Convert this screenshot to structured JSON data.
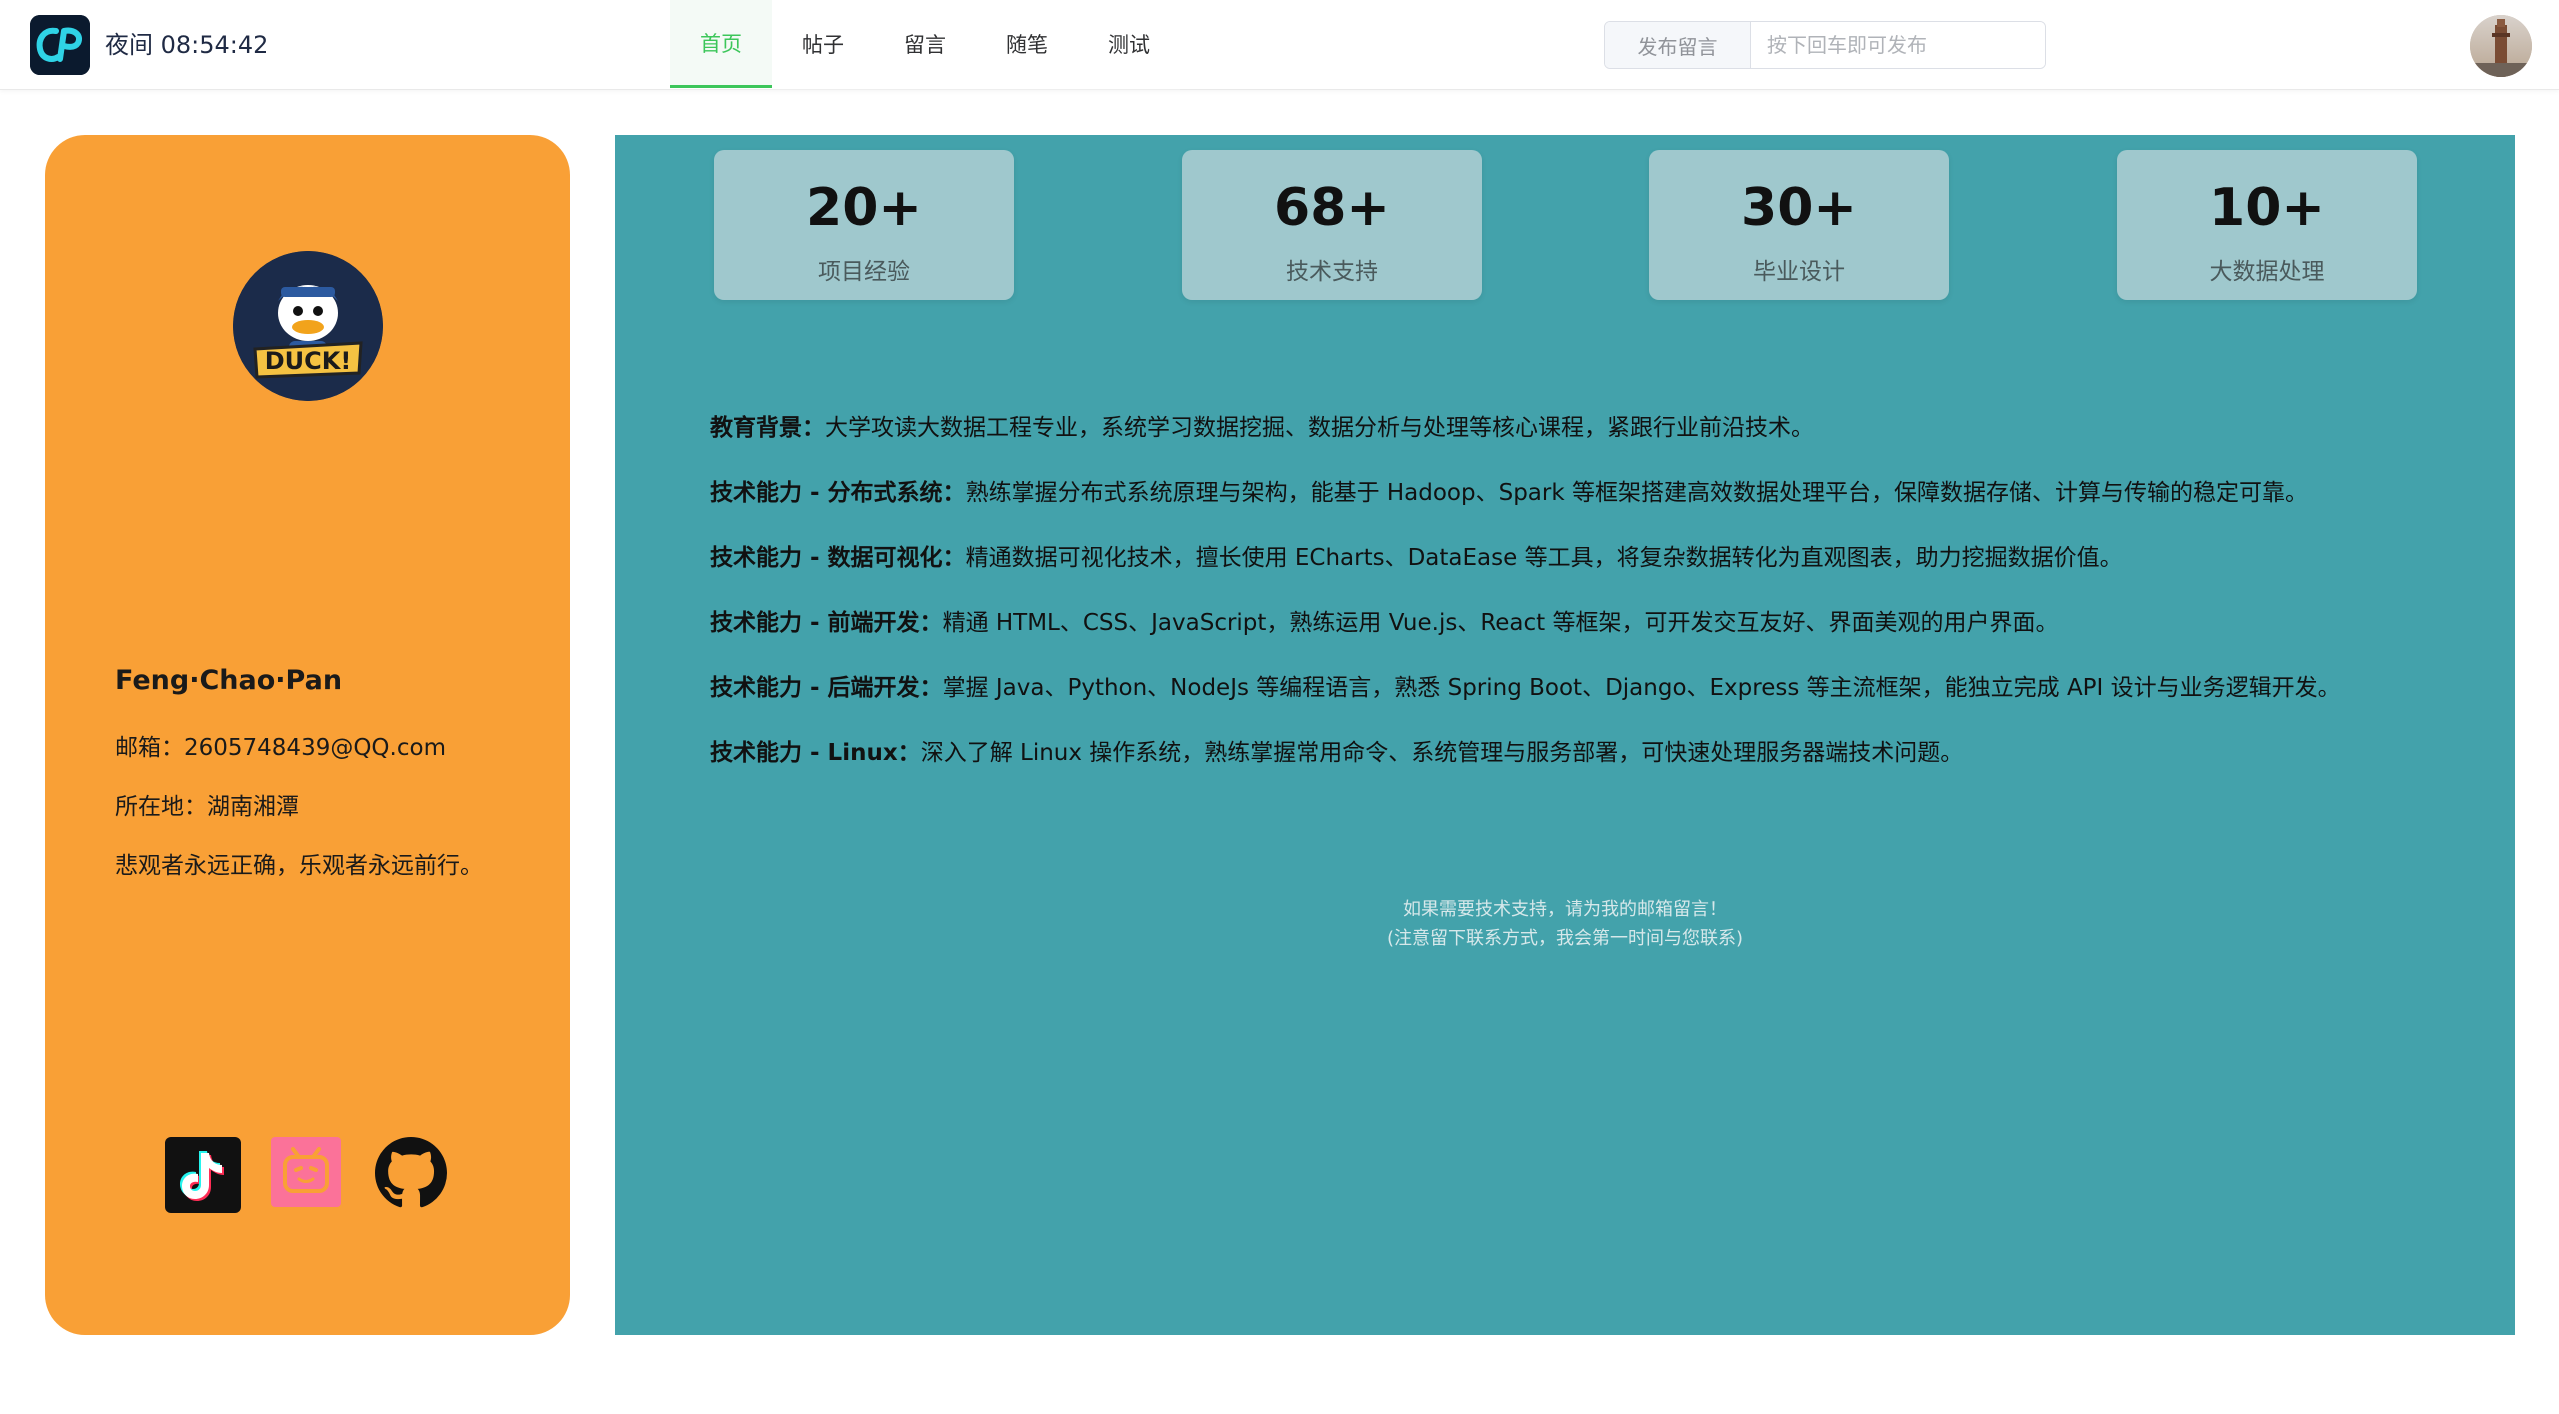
{
  "header": {
    "time_text": "夜间 08:54:42",
    "nav": [
      {
        "label": "首页",
        "active": true
      },
      {
        "label": "帖子",
        "active": false
      },
      {
        "label": "留言",
        "active": false
      },
      {
        "label": "随笔",
        "active": false
      },
      {
        "label": "测试",
        "active": false
      }
    ],
    "post_label": "发布留言",
    "post_placeholder": "按下回车即可发布",
    "post_value": ""
  },
  "profile": {
    "name": "Feng·Chao·Pan",
    "email": "邮箱：2605748439@QQ.com",
    "location": "所在地：湖南湘潭",
    "motto": "悲观者永远正确，乐观者永远前行。",
    "avatar_icon": "donald-duck-avatar",
    "socials": [
      {
        "icon": "tiktok-icon"
      },
      {
        "icon": "bilibili-icon"
      },
      {
        "icon": "github-icon"
      }
    ]
  },
  "stats": [
    {
      "value": "20+",
      "label": "项目经验"
    },
    {
      "value": "68+",
      "label": "技术支持"
    },
    {
      "value": "30+",
      "label": "毕业设计"
    },
    {
      "value": "10+",
      "label": "大数据处理"
    }
  ],
  "paragraphs": [
    {
      "title": "教育背景：",
      "text": "大学攻读大数据工程专业，系统学习数据挖掘、数据分析与处理等核心课程，紧跟行业前沿技术。"
    },
    {
      "title": "技术能力 - 分布式系统：",
      "text": "熟练掌握分布式系统原理与架构，能基于 Hadoop、Spark 等框架搭建高效数据处理平台，保障数据存储、计算与传输的稳定可靠。"
    },
    {
      "title": "技术能力 - 数据可视化：",
      "text": "精通数据可视化技术，擅长使用 ECharts、DataEase 等工具，将复杂数据转化为直观图表，助力挖掘数据价值。"
    },
    {
      "title": "技术能力 - 前端开发：",
      "text": "精通 HTML、CSS、JavaScript，熟练运用 Vue.js、React 等框架，可开发交互友好、界面美观的用户界面。"
    },
    {
      "title": "技术能力 - 后端开发：",
      "text": "掌握 Java、Python、NodeJs 等编程语言，熟悉 Spring Boot、Django、Express 等主流框架，能独立完成 API 设计与业务逻辑开发。"
    },
    {
      "title": "技术能力 - Linux：",
      "text": "深入了解 Linux 操作系统，熟练掌握常用命令、系统管理与服务部署，可快速处理服务器端技术问题。"
    }
  ],
  "note": {
    "line1": "如果需要技术支持，请为我的邮箱留言！",
    "line2": "(注意留下联系方式，我会第一时间与您联系)"
  },
  "colors": {
    "accent": "#3cc65a",
    "profile_bg": "#f9a036",
    "main_bg": "#43a2ab",
    "stat_bg": "#9fc8cd"
  }
}
